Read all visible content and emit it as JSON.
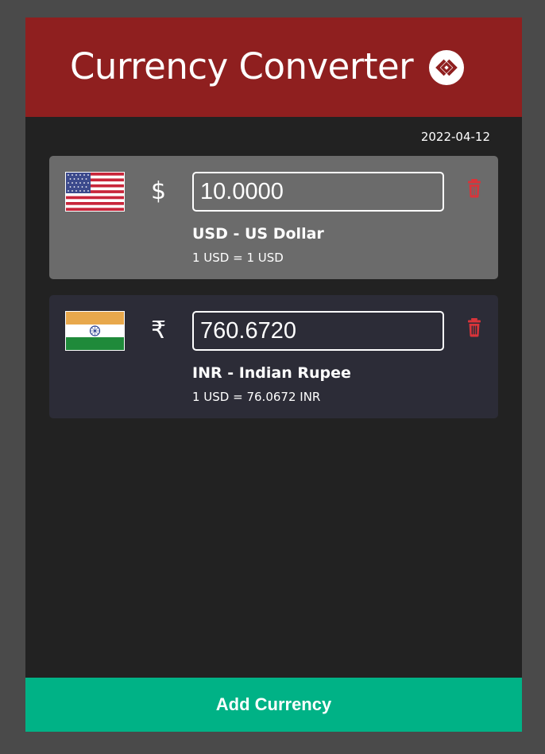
{
  "header": {
    "title": "Currency Converter",
    "logo_icon": "link-icon"
  },
  "date": "2022-04-12",
  "currencies": [
    {
      "flag": "us-flag",
      "symbol": "$",
      "amount": "10.0000",
      "name": "USD - US Dollar",
      "rate": "1 USD = 1 USD",
      "active": true
    },
    {
      "flag": "india-flag",
      "symbol": "₹",
      "amount": "760.6720",
      "name": "INR - Indian Rupee",
      "rate": "1 USD = 76.0672 INR",
      "active": false
    }
  ],
  "footer": {
    "add_label": "Add Currency"
  },
  "colors": {
    "header_bg": "#8f1f1f",
    "active_card_bg": "#6b6b6b",
    "inactive_card_bg": "#2c2c37",
    "delete_icon": "#d9343a",
    "add_button_bg": "#00b286",
    "app_bg": "#222222"
  }
}
